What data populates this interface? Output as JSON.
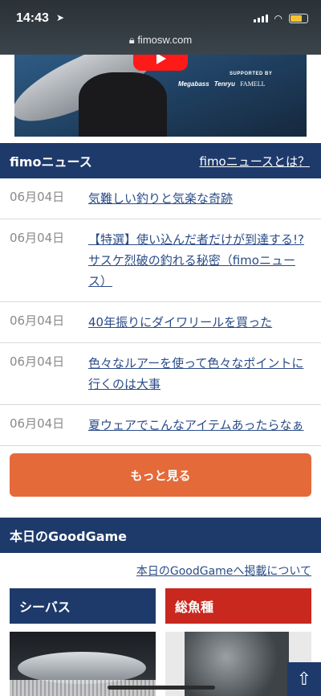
{
  "status_bar": {
    "time": "14:43",
    "location_icon": "location-arrow-icon",
    "url": "fimosw.com",
    "lock_icon": "lock-icon"
  },
  "hero": {
    "supported_by": "SUPPORTED BY",
    "sponsors": [
      "Megabass",
      "Tenryu",
      "FAMELL"
    ],
    "play_icon": "youtube-play-icon"
  },
  "news": {
    "title": "fimoニュース",
    "about_link": "fimoニュースとは？",
    "items": [
      {
        "date": "06月04日",
        "title": "気難しい釣りと気楽な奇跡"
      },
      {
        "date": "06月04日",
        "title": "【特選】使い込んだ者だけが到達する!?サスケ烈破の釣れる秘密（fimoニュース）"
      },
      {
        "date": "06月04日",
        "title": "40年振りにダイワリールを買った"
      },
      {
        "date": "06月04日",
        "title": "色々なルアーを使って色々なポイントに行くのは大事"
      },
      {
        "date": "06月04日",
        "title": "夏ウェアでこんなアイテムあったらなぁ"
      }
    ],
    "more_label": "もっと見る"
  },
  "goodgame": {
    "title": "本日のGoodGame",
    "about_link": "本日のGoodGameへ掲載について",
    "categories": [
      {
        "label": "シーバス",
        "color": "#1e3a6b"
      },
      {
        "label": "総魚種",
        "color": "#c8281e"
      }
    ]
  },
  "scroll_top_icon": "arrow-up-icon",
  "colors": {
    "navy": "#1e3a6b",
    "orange": "#e46a3a",
    "red": "#c8281e",
    "link": "#2b4c88"
  }
}
